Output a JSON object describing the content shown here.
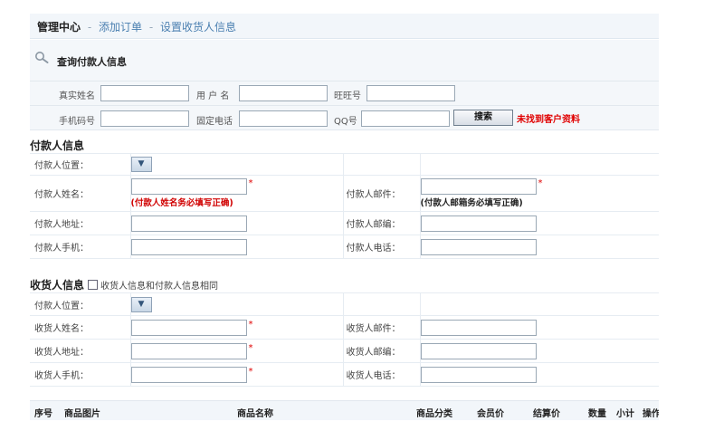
{
  "breadcrumb": {
    "home": "管理中心",
    "sep": "-",
    "items": [
      "添加订单",
      "设置收货人信息"
    ]
  },
  "search": {
    "title": "查询付款人信息",
    "fields": {
      "real_name": "真实姓名",
      "username": "用 户 名",
      "wangwang": "旺旺号",
      "mobile": "手机码号",
      "phone": "固定电话",
      "qq": "QQ号"
    },
    "button": "搜索",
    "not_found": "未找到客户资料"
  },
  "payer": {
    "title": "付款人信息",
    "location_label": "付款人位置：",
    "name_label": "付款人姓名：",
    "name_hint": "(付款人姓名务必填写正确)",
    "email_label": "付款人邮件：",
    "email_hint": "(付款人邮箱务必填写正确)",
    "address_label": "付款人地址：",
    "zip_label": "付款人邮编：",
    "mobile_label": "付款人手机：",
    "phone_label": "付款人电话："
  },
  "receiver": {
    "title": "收货人信息",
    "same_label": "收货人信息和付款人信息相同",
    "location_label": "付款人位置：",
    "name_label": "收货人姓名：",
    "email_label": "收货人邮件：",
    "address_label": "收货人地址：",
    "zip_label": "收货人邮编：",
    "mobile_label": "收货人手机：",
    "phone_label": "收货人电话："
  },
  "required_mark": "*",
  "products": {
    "columns": [
      "序号",
      "商品图片",
      "商品名称",
      "商品分类",
      "会员价",
      "结算价",
      "数量",
      "小计",
      "操作"
    ]
  },
  "colors": {
    "accent_link": "#4a7fb0",
    "error_red": "#e00000"
  }
}
